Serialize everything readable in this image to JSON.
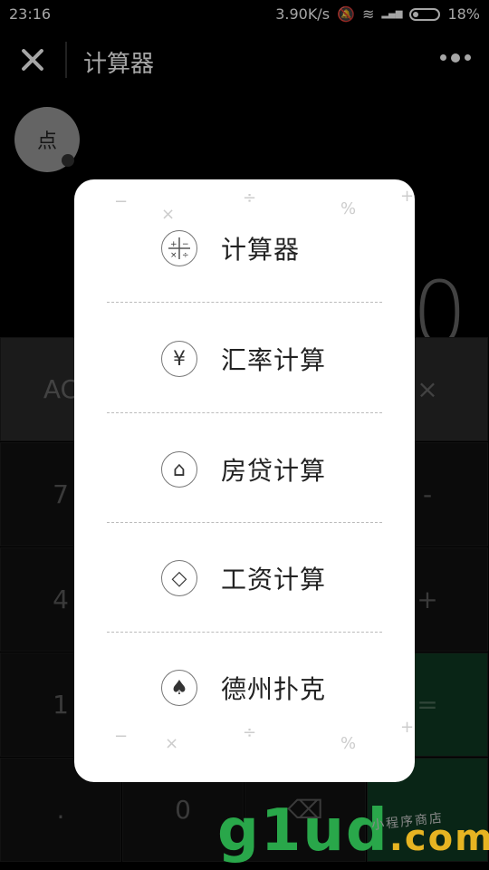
{
  "status_bar": {
    "time": "23:16",
    "speed": "3.90K/s",
    "signal": "4G\n1X",
    "battery": "18%"
  },
  "title_bar": {
    "title": "计算器"
  },
  "float_button": {
    "label": "点"
  },
  "calculator_bg": {
    "display": "0",
    "keys": [
      [
        "AC",
        "",
        "",
        "×"
      ],
      [
        "7",
        "",
        "",
        "-"
      ],
      [
        "4",
        "",
        "",
        "+"
      ],
      [
        "1",
        "",
        "",
        "="
      ],
      [
        ".",
        "0",
        "⌫",
        ""
      ]
    ]
  },
  "menu": {
    "items": [
      {
        "icon": "calculator-icon",
        "glyph": "±",
        "label": "计算器"
      },
      {
        "icon": "yen-icon",
        "glyph": "¥",
        "label": "汇率计算"
      },
      {
        "icon": "house-icon",
        "glyph": "⌂",
        "label": "房贷计算"
      },
      {
        "icon": "wallet-icon",
        "glyph": "◇",
        "label": "工资计算"
      },
      {
        "icon": "poker-icon",
        "glyph": "♠",
        "label": "德州扑克"
      }
    ]
  },
  "watermark": {
    "brand": "g1ud",
    "domain": ".com",
    "tagline": "小程序商店"
  }
}
